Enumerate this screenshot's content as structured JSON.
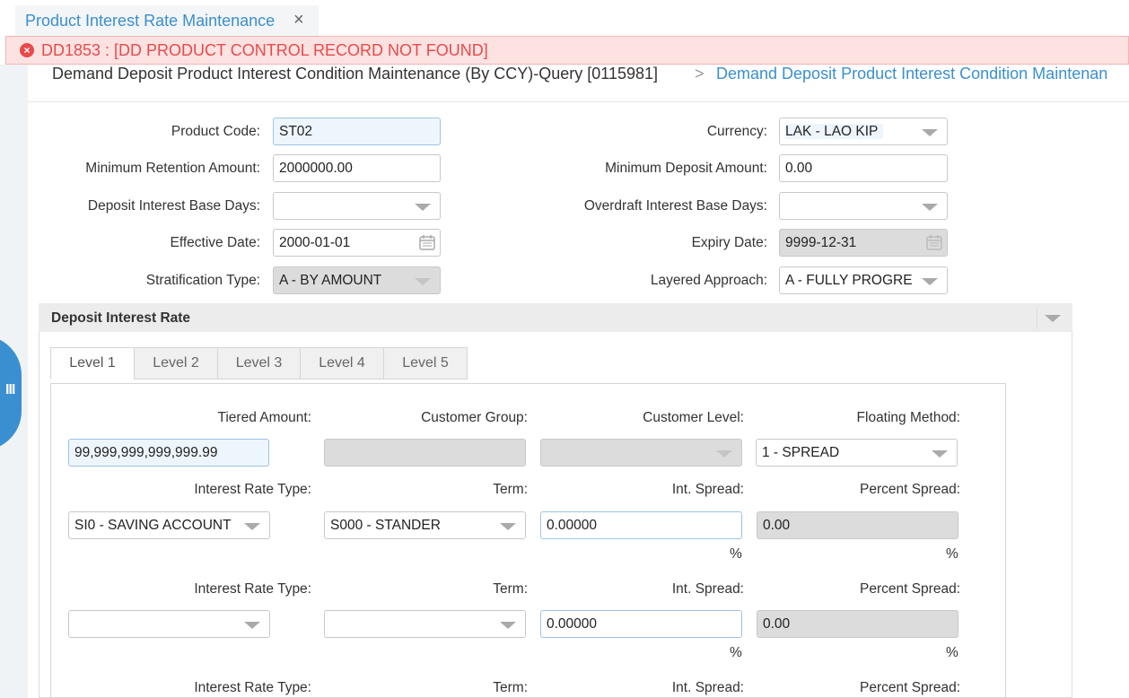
{
  "tab": {
    "title": "Product Interest Rate Maintenance",
    "close": "×"
  },
  "alert": {
    "icon": "×",
    "message": "DD1853 : [DD PRODUCT CONTROL RECORD NOT FOUND]"
  },
  "breadcrumb": {
    "current": "Demand Deposit Product Interest Condition Maintenance (By CCY)-Query [0115981]",
    "separator": ">",
    "next": "Demand Deposit Product Interest Condition Maintenan"
  },
  "form": {
    "product_code": {
      "label": "Product Code:",
      "value": "ST02"
    },
    "currency": {
      "label": "Currency:",
      "value": "LAK - LAO KIP"
    },
    "min_retention": {
      "label": "Minimum Retention Amount:",
      "value": "2000000.00"
    },
    "min_deposit": {
      "label": "Minimum Deposit Amount:",
      "value": "0.00"
    },
    "deposit_base_days": {
      "label": "Deposit Interest Base Days:",
      "value": ""
    },
    "overdraft_base_days": {
      "label": "Overdraft Interest Base Days:",
      "value": ""
    },
    "effective_date": {
      "label": "Effective Date:",
      "value": "2000-01-01"
    },
    "expiry_date": {
      "label": "Expiry Date:",
      "value": "9999-12-31"
    },
    "stratification": {
      "label": "Stratification Type:",
      "value": "A - BY AMOUNT"
    },
    "layered": {
      "label": "Layered Approach:",
      "value": "A - FULLY PROGRE"
    }
  },
  "panel": {
    "title": "Deposit Interest Rate",
    "levels": [
      "Level 1",
      "Level 2",
      "Level 3",
      "Level 4",
      "Level 5"
    ],
    "labels": {
      "tiered_amount": "Tiered Amount:",
      "customer_group": "Customer Group:",
      "customer_level": "Customer Level:",
      "floating_method": "Floating Method:",
      "interest_rate_type": "Interest Rate Type:",
      "term": "Term:",
      "int_spread": "Int. Spread:",
      "percent_spread": "Percent Spread:",
      "percent": "%"
    },
    "tiered_amount": "99,999,999,999,999.99",
    "customer_group": "",
    "customer_level": "",
    "floating_method": "1 - SPREAD",
    "rows": [
      {
        "rate_type": "SI0 - SAVING ACCOUNT",
        "term": "S000 - STANDER",
        "int_spread": "0.00000",
        "percent_spread": "0.00"
      },
      {
        "rate_type": "",
        "term": "",
        "int_spread": "0.00000",
        "percent_spread": "0.00"
      }
    ]
  }
}
